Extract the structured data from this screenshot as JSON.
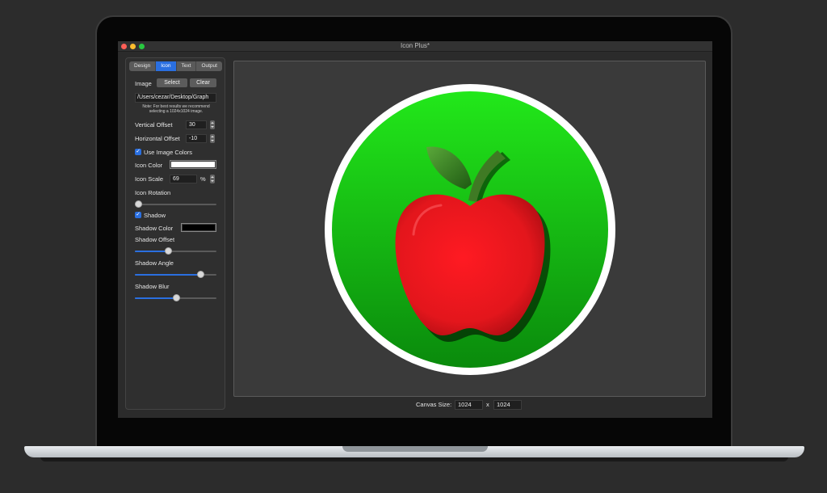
{
  "window": {
    "title": "Icon Plus*"
  },
  "tabs": [
    {
      "label": "Design",
      "active": false
    },
    {
      "label": "Icon",
      "active": true
    },
    {
      "label": "Text",
      "active": false
    },
    {
      "label": "Output",
      "active": false
    }
  ],
  "image": {
    "label": "Image",
    "select_label": "Select",
    "clear_label": "Clear",
    "path": "/Users/cezar/Desktop/Graph",
    "note_line1": "Note: For best results we recommend",
    "note_line2": "selecting a 1024x1024 image."
  },
  "vertical_offset": {
    "label": "Vertical Offset",
    "value": "30"
  },
  "horizontal_offset": {
    "label": "Horizontal Offset",
    "value": "-10"
  },
  "use_image_colors": {
    "label": "Use Image Colors",
    "checked": true
  },
  "icon_color": {
    "label": "Icon Color",
    "color": "#ffffff"
  },
  "icon_scale": {
    "label": "Icon Scale",
    "value": "69",
    "unit": "%"
  },
  "icon_rotation": {
    "label": "Icon Rotation",
    "value_fraction": 0.0
  },
  "shadow": {
    "label": "Shadow",
    "checked": true
  },
  "shadow_color": {
    "label": "Shadow Color",
    "color": "#000000"
  },
  "shadow_offset": {
    "label": "Shadow Offset",
    "value_fraction": 0.4
  },
  "shadow_angle": {
    "label": "Shadow Angle",
    "value_fraction": 0.83
  },
  "shadow_blur": {
    "label": "Shadow Blur",
    "value_fraction": 0.5
  },
  "canvas": {
    "label": "Canvas Size:",
    "width": "1024",
    "separator": "x",
    "height": "1024"
  },
  "colors": {
    "accent": "#2a6fe0",
    "circle_green_light": "#22e81a",
    "circle_green_dark": "#0a8a0c",
    "apple_red": "#e3161c",
    "leaf_green": "#3b8a22"
  },
  "icons": {
    "preview": "apple-icon"
  }
}
